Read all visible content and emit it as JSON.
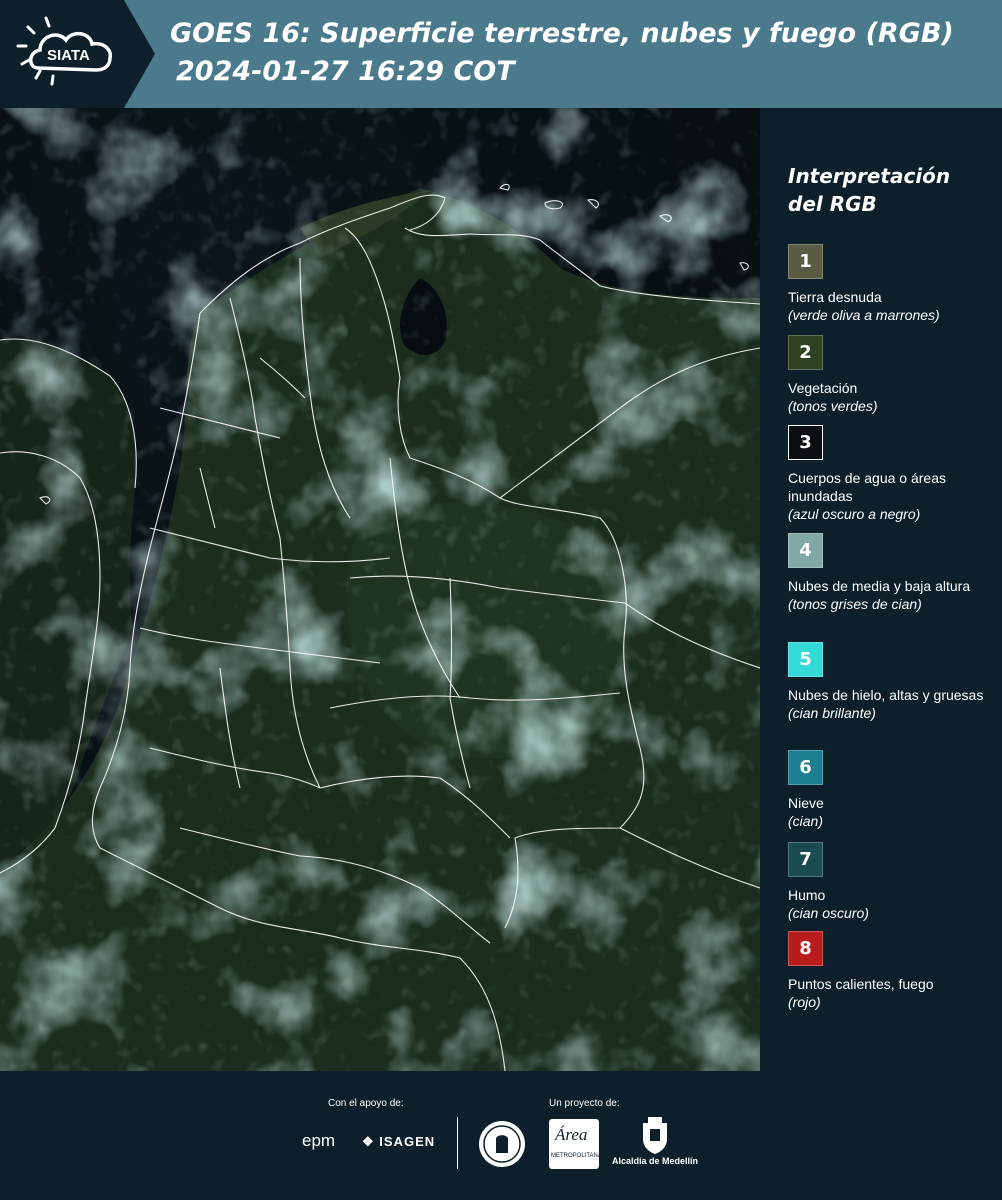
{
  "header": {
    "logo_text": "SIATA",
    "title_line1": "GOES 16: Superficie terrestre, nubes y fuego (RGB)",
    "title_line2": "2024-01-27 16:29 COT",
    "logo_icon": "sun-cloud-icon"
  },
  "legend": {
    "title": "Interpretación del RGB",
    "items": [
      {
        "number": "1",
        "label": "Tierra desnuda",
        "desc": "(verde oliva a marrones)",
        "color": "#5b5b44"
      },
      {
        "number": "2",
        "label": "Vegetación",
        "desc": "(tonos verdes)",
        "color": "#2e4221"
      },
      {
        "number": "3",
        "label": "Cuerpos de agua o áreas inundadas",
        "desc": "(azul oscuro a negro)",
        "color": "#0b0f14"
      },
      {
        "number": "4",
        "label": "Nubes de media y baja altura",
        "desc": "(tonos grises de cian)",
        "color": "#7fa8a6"
      },
      {
        "number": "5",
        "label": "Nubes de hielo, altas y gruesas",
        "desc": "(cian brillante)",
        "color": "#35d9d7"
      },
      {
        "number": "6",
        "label": "Nieve",
        "desc": "(cian)",
        "color": "#1c7e91"
      },
      {
        "number": "7",
        "label": "Humo",
        "desc": "(cian oscuro)",
        "color": "#1a4b4f"
      },
      {
        "number": "8",
        "label": "Puntos calientes, fuego",
        "desc": "(rojo)",
        "color": "#b91c1c"
      }
    ]
  },
  "footer": {
    "support_label": "Con el apoyo de:",
    "project_label": "Un proyecto de:",
    "epm": "epm",
    "isagen": "ISAGEN",
    "alcaldia": "Alcaldía de Medellín",
    "area_metro_label": "Área",
    "area_metro_sub": "METROPOLITANA"
  },
  "colors": {
    "header_bg": "#4b7a8c",
    "panel_bg": "#0d1f2b",
    "border_lines": "#ffffff"
  }
}
